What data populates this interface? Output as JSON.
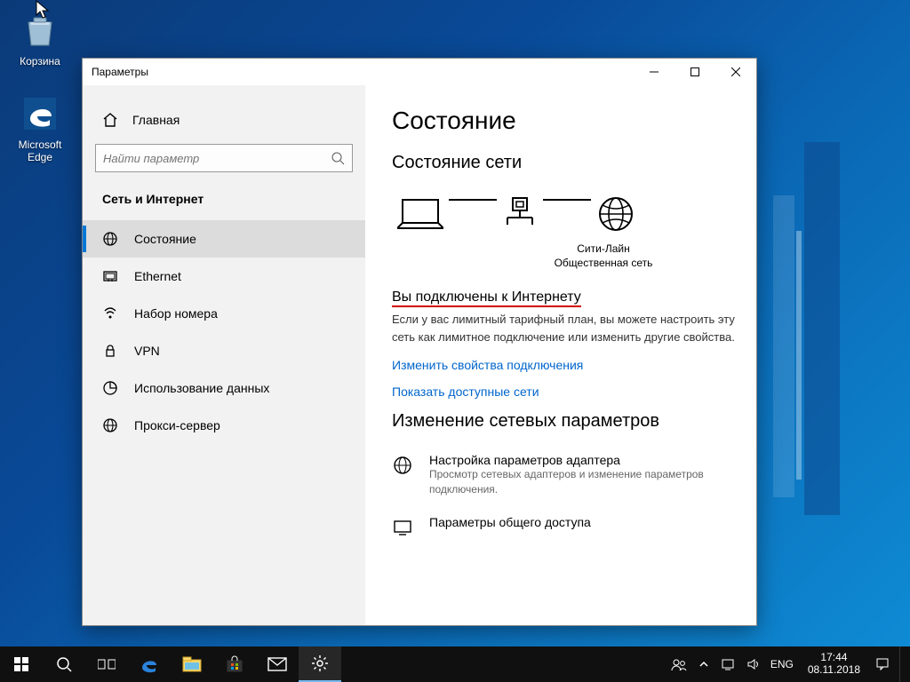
{
  "desktop": {
    "icons": [
      {
        "name": "Корзина"
      },
      {
        "name": "Microsoft Edge"
      }
    ]
  },
  "window": {
    "title": "Параметры",
    "home_label": "Главная",
    "search_placeholder": "Найти параметр",
    "category": "Сеть и Интернет",
    "nav": [
      {
        "label": "Состояние"
      },
      {
        "label": "Ethernet"
      },
      {
        "label": "Набор номера"
      },
      {
        "label": "VPN"
      },
      {
        "label": "Использование данных"
      },
      {
        "label": "Прокси-сервер"
      }
    ],
    "content": {
      "heading": "Состояние",
      "network_status_heading": "Состояние сети",
      "diagram": {
        "network_name": "Сити-Лайн",
        "network_type": "Общественная сеть"
      },
      "connected_heading": "Вы подключены к Интернету",
      "connected_body": "Если у вас лимитный тарифный план, вы можете настроить эту сеть как лимитное подключение или изменить другие свойства.",
      "link_change_props": "Изменить свойства подключения",
      "link_show_nets": "Показать доступные сети",
      "change_params_heading": "Изменение сетевых параметров",
      "options": [
        {
          "title": "Настройка параметров адаптера",
          "desc": "Просмотр сетевых адаптеров и изменение параметров подключения."
        },
        {
          "title": "Параметры общего доступа",
          "desc": ""
        }
      ]
    }
  },
  "taskbar": {
    "lang": "ENG",
    "time": "17:44",
    "date": "08.11.2018"
  }
}
